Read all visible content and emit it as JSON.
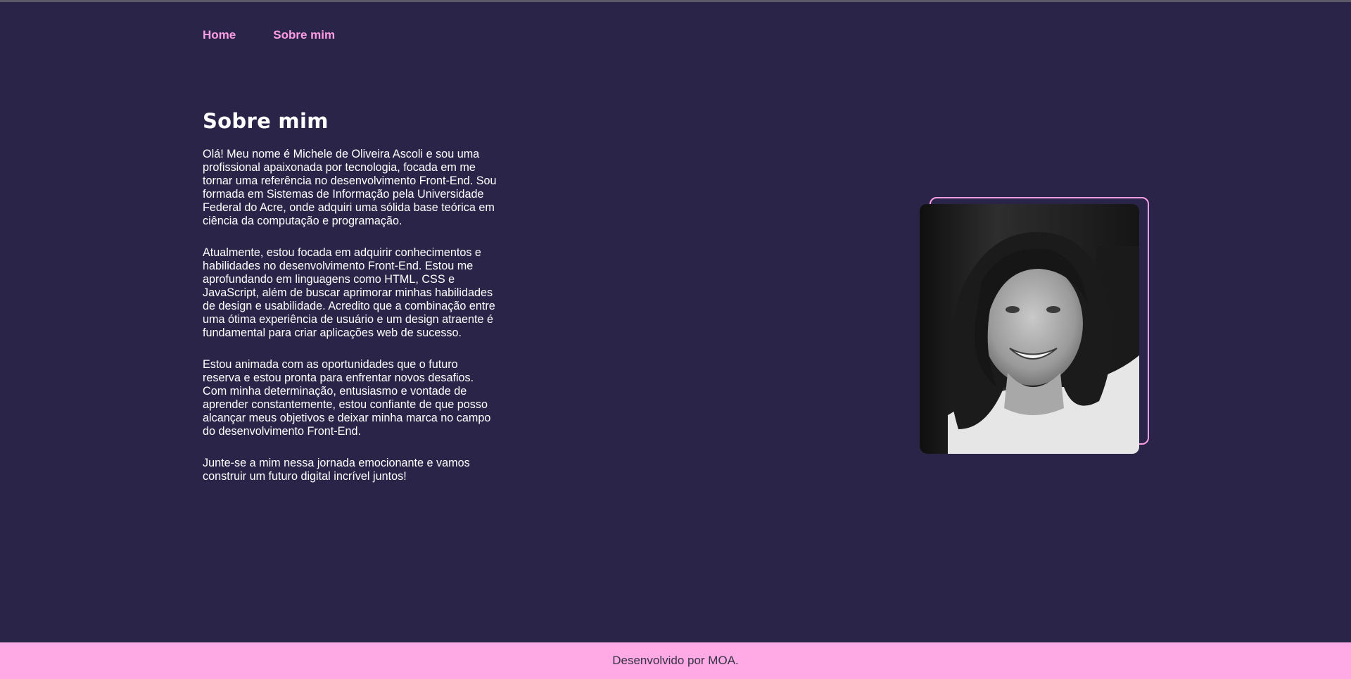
{
  "nav": {
    "items": [
      {
        "label": "Home"
      },
      {
        "label": "Sobre mim"
      }
    ]
  },
  "about": {
    "title": "Sobre mim",
    "paragraphs": [
      "Olá! Meu nome é Michele de Oliveira Ascoli e sou uma profissional apaixonada por tecnologia, focada em me tornar uma referência no desenvolvimento Front-End. Sou formada em Sistemas de Informação pela Universidade Federal do Acre, onde adquiri uma sólida base teórica em ciência da computação e programação.",
      "Atualmente, estou focada em adquirir conhecimentos e habilidades no desenvolvimento Front-End. Estou me aprofundando em linguagens como HTML, CSS e JavaScript, além de buscar aprimorar minhas habilidades de design e usabilidade. Acredito que a combinação entre uma ótima experiência de usuário e um design atraente é fundamental para criar aplicações web de sucesso.",
      "Estou animada com as oportunidades que o futuro reserva e estou pronta para enfrentar novos desafios. Com minha determinação, entusiasmo e vontade de aprender constantemente, estou confiante de que posso alcançar meus objetivos e deixar minha marca no campo do desenvolvimento Front-End.",
      "Junte-se a mim nessa jornada emocionante e vamos construir um futuro digital incrível juntos!"
    ]
  },
  "photo": {
    "icon": "profile-photo"
  },
  "footer": {
    "text": "Desenvolvido por MOA."
  },
  "colors": {
    "background": "#2a2449",
    "accent": "#ff9ee3",
    "footer_background": "#ffa9e5",
    "text": "#ffffff"
  }
}
